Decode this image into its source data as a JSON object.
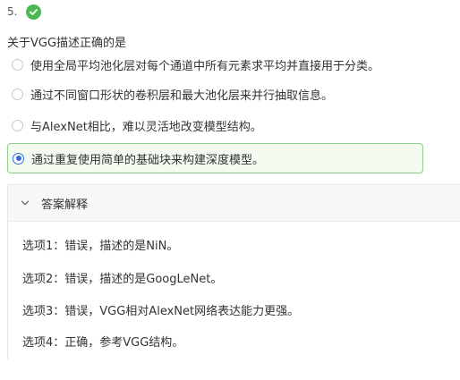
{
  "question": {
    "number": "5.",
    "status_icon": "check-circle-icon",
    "status_color": "#4cb84f",
    "title": "关于VGG描述正确的是"
  },
  "options": [
    {
      "label": "使用全局平均池化层对每个通道中所有元素求平均并直接用于分类。",
      "selected": false
    },
    {
      "label": "通过不同窗口形状的卷积层和最大池化层来并行抽取信息。",
      "selected": false
    },
    {
      "label": "与AlexNet相比，难以灵活地改变模型结构。",
      "selected": false
    },
    {
      "label": "通过重复使用简单的基础块来构建深度模型。",
      "selected": true
    }
  ],
  "explanation": {
    "title": "答案解释",
    "expanded": true,
    "lines": [
      "选项1：错误，描述的是NiN。",
      "选项2：错误，描述的是GoogLeNet。",
      "选项3：错误，VGG相对AlexNet网络表达能力更强。",
      "选项4：正确，参考VGG结构。"
    ]
  },
  "colors": {
    "selected_border": "#8fcf8a",
    "selected_background": "#f3fbf1",
    "radio_selected": "#2e6bd6"
  }
}
